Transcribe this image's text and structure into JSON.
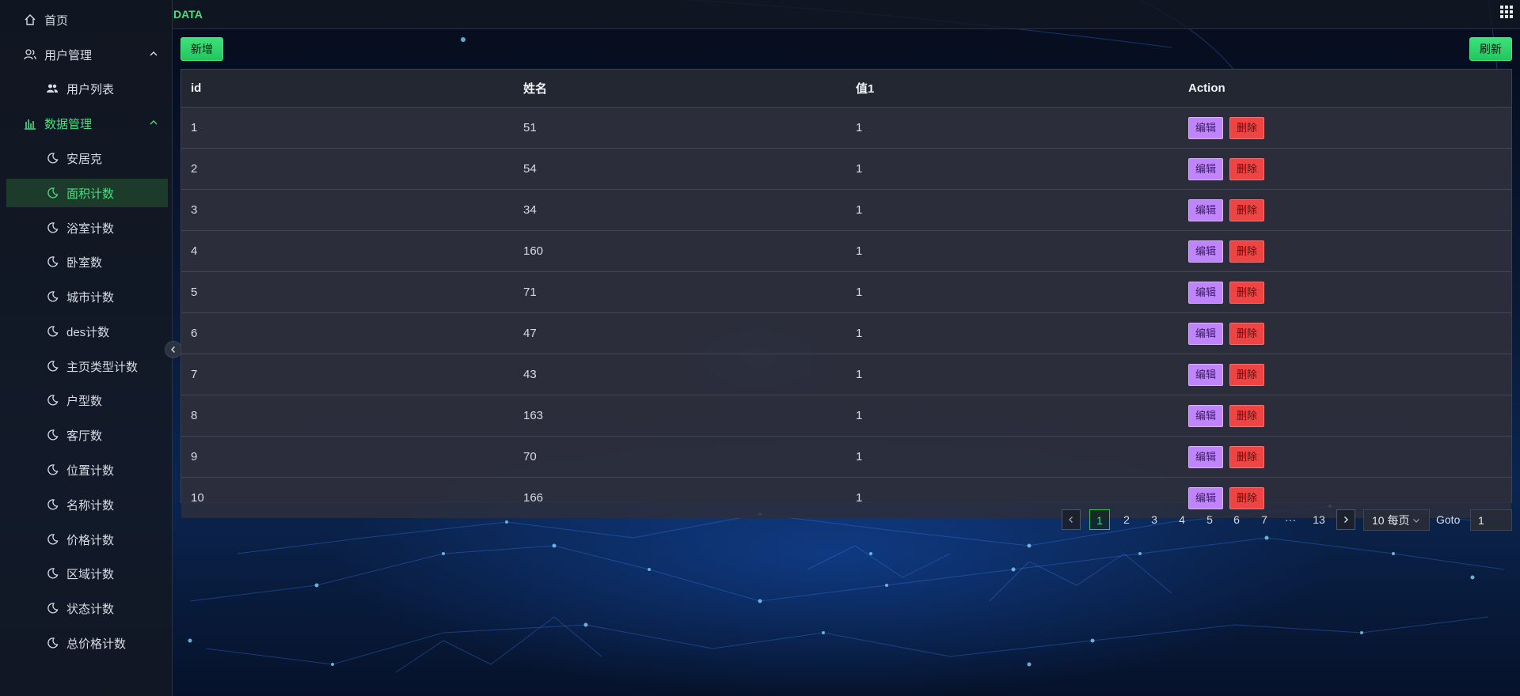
{
  "header": {
    "title": "DATA"
  },
  "sidebar": {
    "items": [
      {
        "label": "首页"
      },
      {
        "label": "用户管理"
      },
      {
        "label": "用户列表"
      },
      {
        "label": "数据管理"
      },
      {
        "label": "安居克"
      },
      {
        "label": "面积计数"
      },
      {
        "label": "浴室计数"
      },
      {
        "label": "卧室数"
      },
      {
        "label": "城市计数"
      },
      {
        "label": "des计数"
      },
      {
        "label": "主页类型计数"
      },
      {
        "label": "户型数"
      },
      {
        "label": "客厅数"
      },
      {
        "label": "位置计数"
      },
      {
        "label": "名称计数"
      },
      {
        "label": "价格计数"
      },
      {
        "label": "区域计数"
      },
      {
        "label": "状态计数"
      },
      {
        "label": "总价格计数"
      }
    ],
    "active": "面积计数"
  },
  "toolbar": {
    "add_label": "新增",
    "refresh_label": "刷新"
  },
  "table": {
    "columns": [
      "id",
      "姓名",
      "值1",
      "Action"
    ],
    "rows": [
      [
        "1",
        "51",
        "1"
      ],
      [
        "2",
        "54",
        "1"
      ],
      [
        "3",
        "34",
        "1"
      ],
      [
        "4",
        "160",
        "1"
      ],
      [
        "5",
        "71",
        "1"
      ],
      [
        "6",
        "47",
        "1"
      ],
      [
        "7",
        "43",
        "1"
      ],
      [
        "8",
        "163",
        "1"
      ],
      [
        "9",
        "70",
        "1"
      ],
      [
        "10",
        "166",
        "1"
      ]
    ],
    "edit_label": "编辑",
    "delete_label": "删除"
  },
  "pagination": {
    "pages": [
      "1",
      "2",
      "3",
      "4",
      "5",
      "6",
      "7",
      "···",
      "13"
    ],
    "current": "1",
    "page_size": "10 每页",
    "goto_label": "Goto",
    "goto_value": "1"
  },
  "colors": {
    "accent": "#22c55e",
    "edit": "#c084fc",
    "delete": "#ef4444"
  }
}
